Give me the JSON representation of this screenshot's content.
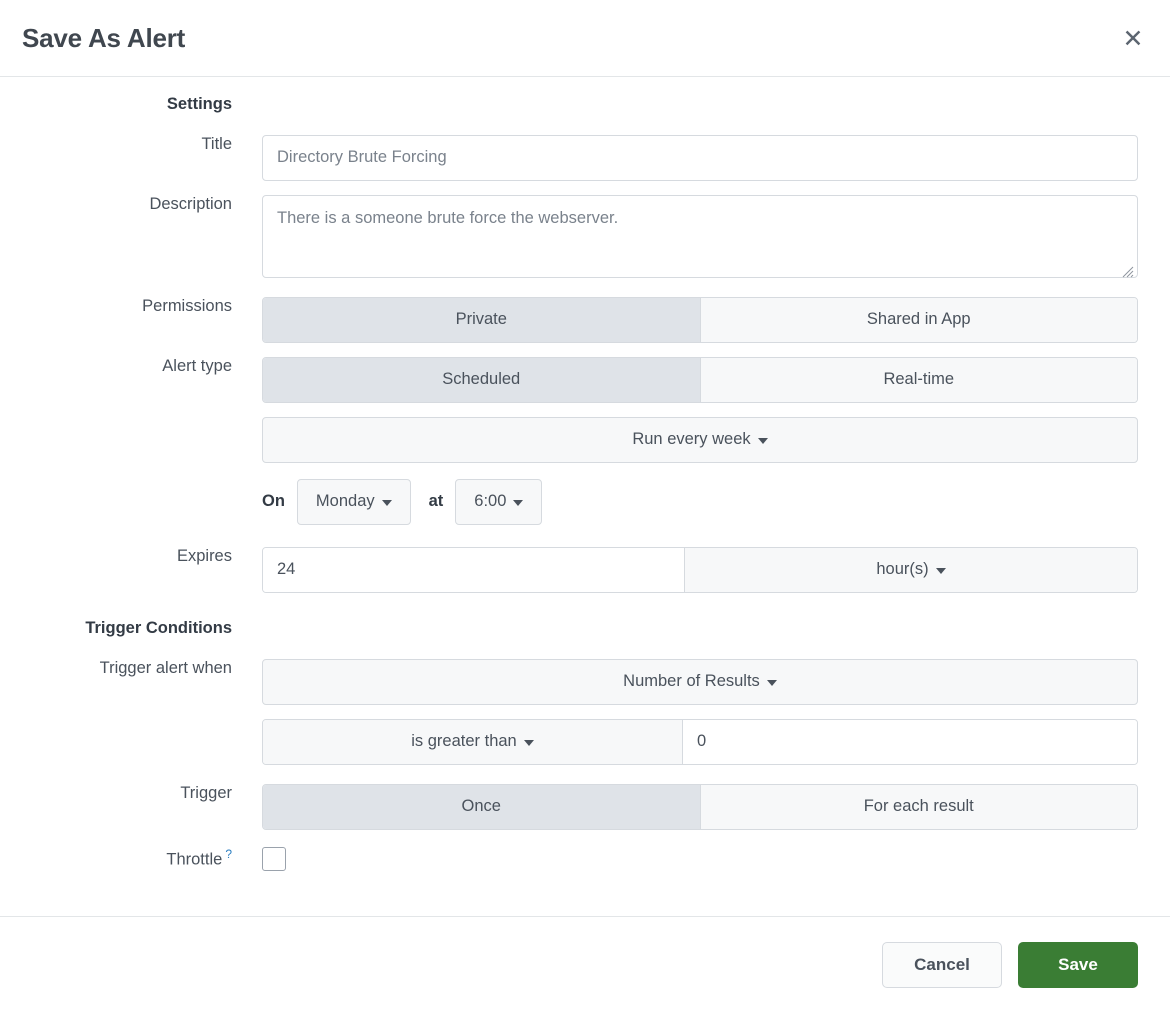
{
  "header": {
    "title": "Save As Alert",
    "close_icon": "close-icon",
    "close_glyph": "✕"
  },
  "settings": {
    "section_label": "Settings",
    "title": {
      "label": "Title",
      "value": "Directory Brute Forcing",
      "placeholder": "Directory Brute Forcing"
    },
    "description": {
      "label": "Description",
      "value": "There is a someone brute force the webserver.",
      "placeholder": "There is a someone brute force the webserver."
    },
    "permissions": {
      "label": "Permissions",
      "options": [
        "Private",
        "Shared in App"
      ],
      "selected": "Private"
    },
    "alert_type": {
      "label": "Alert type",
      "options": [
        "Scheduled",
        "Real-time"
      ],
      "selected": "Scheduled"
    },
    "schedule": {
      "frequency": "Run every week",
      "on_label": "On",
      "day": "Monday",
      "at_label": "at",
      "time": "6:00"
    },
    "expires": {
      "label": "Expires",
      "value": "24",
      "unit": "hour(s)"
    }
  },
  "trigger_conditions": {
    "section_label": "Trigger Conditions",
    "trigger_alert_when": {
      "label": "Trigger alert when",
      "metric": "Number of Results",
      "operator": "is greater than",
      "threshold": "0"
    },
    "trigger": {
      "label": "Trigger",
      "options": [
        "Once",
        "For each result"
      ],
      "selected": "Once"
    },
    "throttle": {
      "label": "Throttle",
      "help_glyph": "?",
      "checked": false
    }
  },
  "footer": {
    "cancel_label": "Cancel",
    "save_label": "Save"
  },
  "colors": {
    "save_green": "#3a7d34",
    "selected_segment": "#dfe3e8",
    "unselected_segment": "#f7f8f9",
    "border": "#d6dadf",
    "help_link_blue": "#2b7ec1",
    "text": "#4a525c"
  }
}
